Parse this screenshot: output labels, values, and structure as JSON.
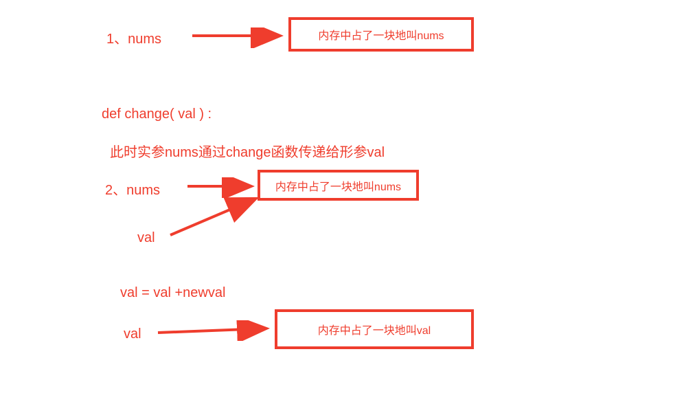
{
  "row1": {
    "label": "1、nums",
    "box": "内存中占了一块地叫nums"
  },
  "defLine": "def change( val ) :",
  "description": "此时实参nums通过change函数传递给形参val",
  "row2": {
    "label": "2、nums",
    "box": "内存中占了一块地叫nums"
  },
  "valLabel": "val",
  "assignment": "val = val +newval",
  "valLabel2": "val",
  "box3": "内存中占了一块地叫val"
}
